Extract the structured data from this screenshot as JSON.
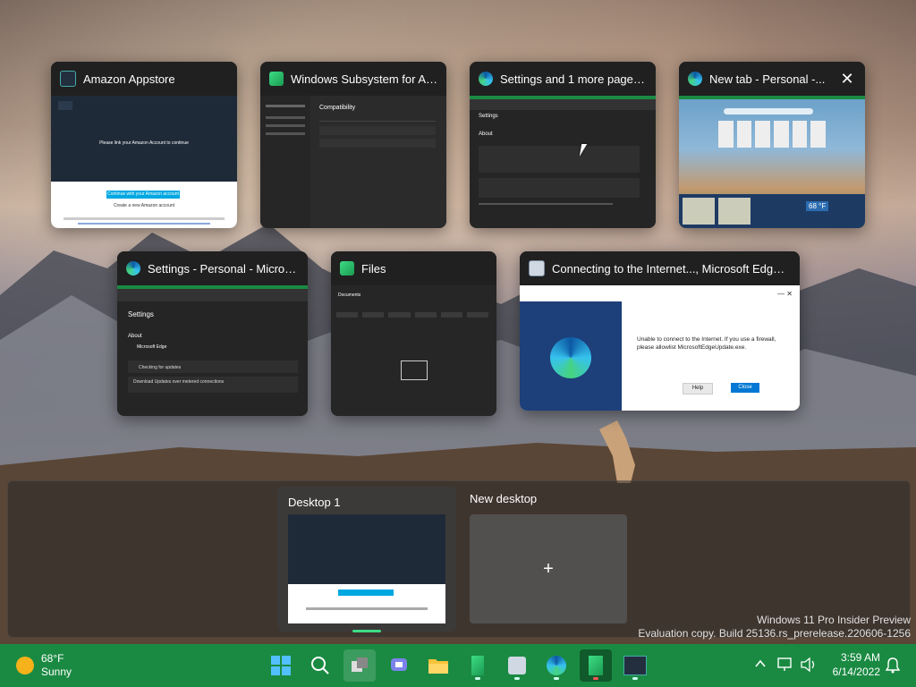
{
  "windows": [
    {
      "title": "Amazon Appstore",
      "icon": "amazon-appstore-icon",
      "body_text": "Please link your Amazon Account to continue",
      "button": "Continue with your Amazon account",
      "link": "Create a new Amazon account"
    },
    {
      "title": "Windows Subsystem for An...",
      "icon": "wsa-icon",
      "body_heading": "Compatibility",
      "rows": [
        "Installed Apps",
        "Apps forward"
      ]
    },
    {
      "title": "Settings and 1 more page -...",
      "icon": "edge-icon",
      "page_heading": "Settings",
      "section": "About"
    },
    {
      "title": "New tab - Personal -...",
      "icon": "edge-icon",
      "weather": "68 °F"
    },
    {
      "title": "Settings - Personal - Microso...",
      "icon": "edge-icon",
      "page_heading": "Settings",
      "section": "About",
      "app_name": "Microsoft Edge",
      "status": "Checking for updates",
      "setting": "Download Updates over metered connections"
    },
    {
      "title": "Files",
      "icon": "files-icon",
      "folder": "Documents"
    },
    {
      "title": "Connecting to the Internet..., Microsoft Edge Ca...",
      "icon": "edge-setup-icon",
      "message": "Unable to connect to the Internet. If you use a firewall, please allowlist MicrosoftEdgeUpdate.exe.",
      "help_label": "Help",
      "close_label": "Close"
    }
  ],
  "desktops": {
    "desktop1_label": "Desktop 1",
    "new_desktop_label": "New desktop",
    "add_glyph": "+"
  },
  "watermark": {
    "line1": "Windows 11 Pro Insider Preview",
    "line2": "Evaluation copy. Build 25136.rs_prerelease.220606-1256"
  },
  "taskbar": {
    "weather_temp": "68°F",
    "weather_cond": "Sunny",
    "time": "3:59 AM",
    "date": "6/14/2022"
  },
  "colors": {
    "taskbar": "#1a8a42",
    "accent": "#0078d4",
    "appstore_button": "#00a8e1"
  }
}
